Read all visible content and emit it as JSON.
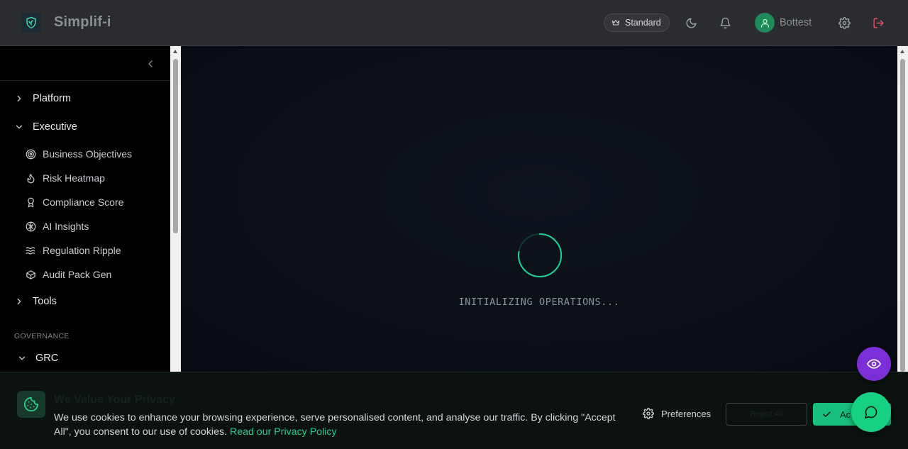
{
  "header": {
    "app_title": "Simplif-i",
    "logo_icon": "shield-leaf-icon",
    "plan_label": "Standard",
    "plan_icon": "crown-icon",
    "username": "Bottest",
    "icons": [
      "moon-icon",
      "bell-icon",
      "user-icon",
      "gear-icon",
      "logout-icon"
    ]
  },
  "sidebar": {
    "collapse_icon": "chevron-left-icon",
    "groups": [
      {
        "label": "Platform",
        "expanded": false
      },
      {
        "label": "Executive",
        "expanded": true
      },
      {
        "label": "Tools",
        "expanded": false
      },
      {
        "label": "GRC",
        "expanded": true
      }
    ],
    "executive_items": [
      {
        "label": "Business Objectives",
        "icon": "target-icon"
      },
      {
        "label": "Risk Heatmap",
        "icon": "flame-icon"
      },
      {
        "label": "Compliance Score",
        "icon": "award-icon"
      },
      {
        "label": "AI Insights",
        "icon": "brain-icon"
      },
      {
        "label": "Regulation Ripple",
        "icon": "waves-icon"
      },
      {
        "label": "Audit Pack Gen",
        "icon": "package-icon"
      }
    ],
    "section_label": "GOVERNANCE"
  },
  "main": {
    "loading_text": "INITIALIZING OPERATIONS...",
    "accent_color": "#1ed397"
  },
  "cookie_banner": {
    "title": "We Value Your Privacy",
    "text": "We use cookies to enhance your browsing experience, serve personalised content, and analyse our traffic. By clicking \"Accept All\", you consent to our use of cookies.",
    "link_text": "Read our Privacy Policy",
    "preferences_label": "Preferences",
    "reject_label": "Reject All",
    "accept_label": "Accept All",
    "accept_visible_label": "Ac"
  },
  "floating": {
    "eye_icon": "eye-icon",
    "chat_icon": "chat-icon"
  }
}
